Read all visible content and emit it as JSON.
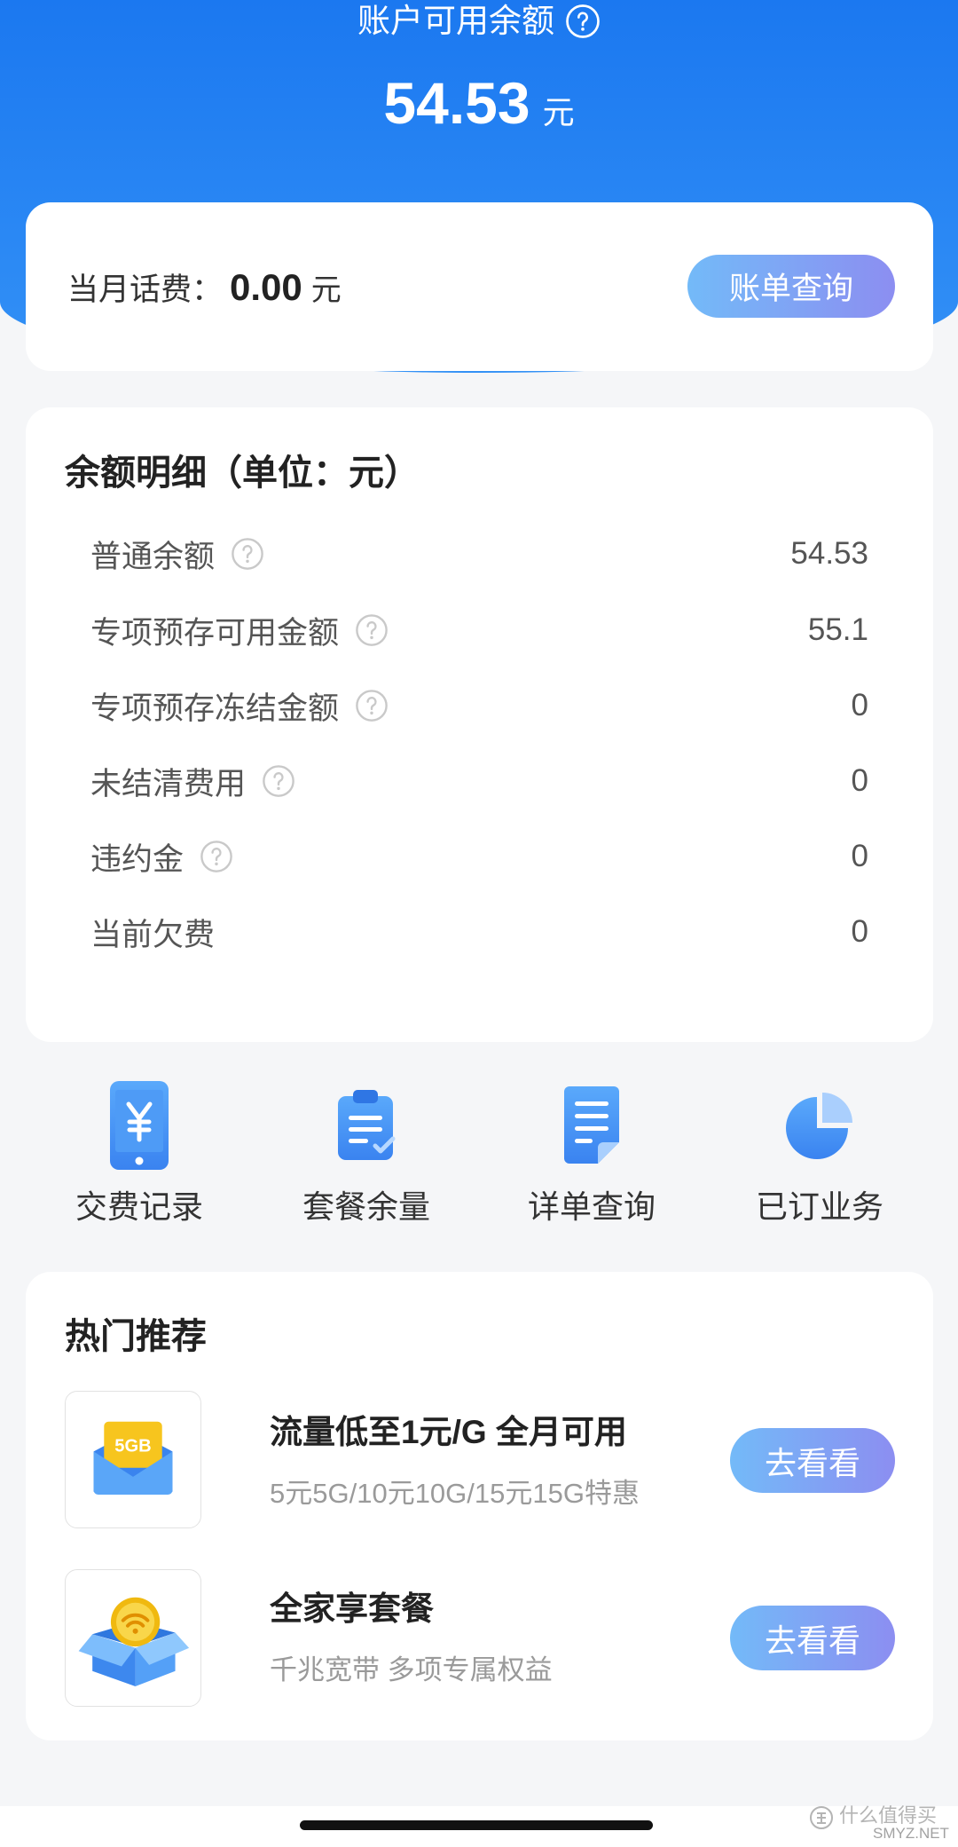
{
  "header": {
    "title": "账户可用余额",
    "help_icon": "question-circle-icon",
    "balance": "54.53",
    "unit": "元"
  },
  "monthly_fee": {
    "label": "当月话费：",
    "amount": "0.00",
    "unit": "元",
    "bill_button": "账单查询"
  },
  "balance_detail": {
    "title": "余额明细（单位：元）",
    "rows": [
      {
        "label": "普通余额",
        "value": "54.53",
        "help_icon": "question-circle-icon"
      },
      {
        "label": "专项预存可用金额",
        "value": "55.1",
        "help_icon": "question-circle-icon"
      },
      {
        "label": "专项预存冻结金额",
        "value": "0",
        "help_icon": "question-circle-icon"
      },
      {
        "label": "未结清费用",
        "value": "0",
        "help_icon": "question-circle-icon"
      },
      {
        "label": "违约金",
        "value": "0",
        "help_icon": "question-circle-icon"
      },
      {
        "label": "当前欠费",
        "value": "0"
      }
    ]
  },
  "shortcuts": [
    {
      "label": "交费记录",
      "icon": "phone-yuan-icon"
    },
    {
      "label": "套餐余量",
      "icon": "clipboard-check-icon"
    },
    {
      "label": "详单查询",
      "icon": "document-list-icon"
    },
    {
      "label": "已订业务",
      "icon": "pie-chart-icon"
    }
  ],
  "recommend": {
    "title": "热门推荐",
    "items": [
      {
        "title": "流量低至1元/G 全月可用",
        "subtitle": "5元5G/10元10G/15元15G特惠",
        "button": "去看看",
        "thumb_icon": "data-envelope-icon",
        "thumb_text": "5GB"
      },
      {
        "title": "全家享套餐",
        "subtitle": "千兆宽带 多项专属权益",
        "button": "去看看",
        "thumb_icon": "wifi-box-icon"
      }
    ]
  },
  "watermark": {
    "text": "什么值得买",
    "site": "SMYZ.NET"
  },
  "colors": {
    "header_blue": "#1b78f0",
    "button_gradient_start": "#73baf8",
    "button_gradient_end": "#8c8ef1",
    "page_background": "#f5f6f8",
    "card_background": "#ffffff",
    "icon_blue": "#3d88f2"
  }
}
